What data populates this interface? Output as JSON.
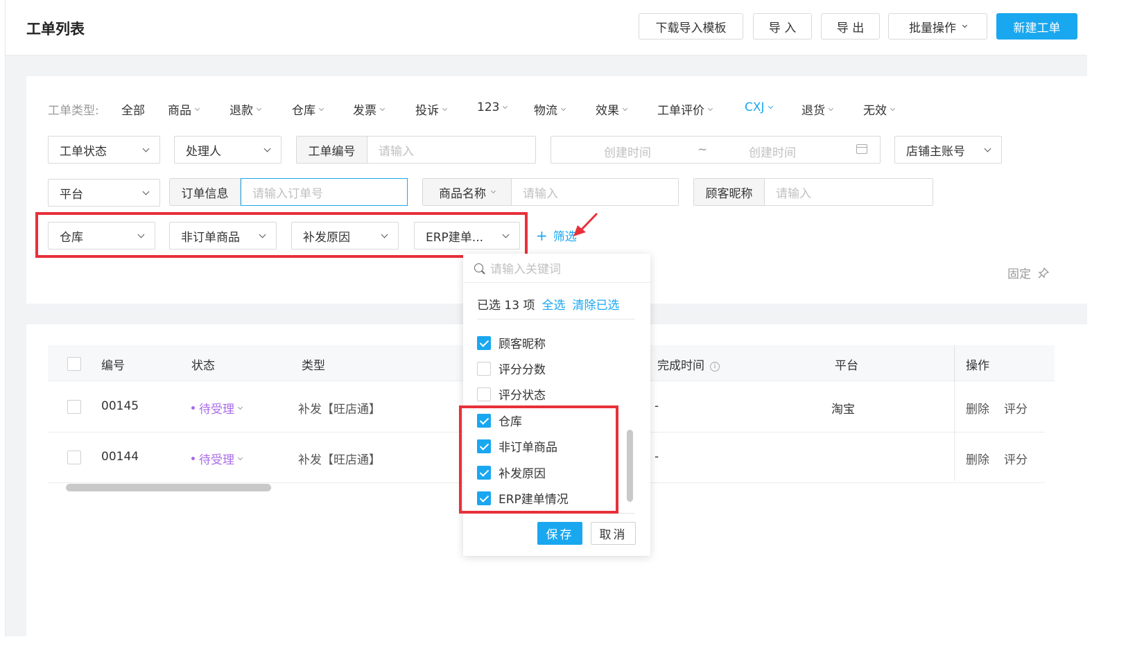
{
  "header": {
    "title": "工单列表",
    "buttons": {
      "download_template": "下载导入模板",
      "import": "导 入",
      "export": "导 出",
      "batch": "批量操作",
      "new_ticket": "新建工单"
    }
  },
  "type_tabs": {
    "label": "工单类型:",
    "items": [
      "全部",
      "商品",
      "退款",
      "仓库",
      "发票",
      "投诉",
      "123",
      "物流",
      "效果",
      "工单评价",
      "CXJ",
      "退货",
      "无效"
    ],
    "active_index": 10
  },
  "filters": {
    "row1": {
      "status": "工单状态",
      "handler": "处理人",
      "ticket_no_label": "工单编号",
      "ticket_no_placeholder": "请输入",
      "date_start": "创建时间",
      "date_sep": "~",
      "date_end": "创建时间",
      "shop_account": "店铺主账号"
    },
    "row2": {
      "platform": "平台",
      "order_info_label": "订单信息",
      "order_info_placeholder": "请输入订单号",
      "product_name_label": "商品名称",
      "product_name_placeholder": "请输入",
      "customer_nick_label": "顾客昵称",
      "customer_nick_placeholder": "请输入"
    },
    "row3": {
      "warehouse": "仓库",
      "non_order_product": "非订单商品",
      "reissue_reason": "补发原因",
      "erp_order": "ERP建单..."
    },
    "add_filter": "筛选",
    "pin": "固定"
  },
  "table": {
    "columns": [
      "编号",
      "状态",
      "类型",
      "完成时间",
      "平台",
      "操作"
    ],
    "rows": [
      {
        "id": "00145",
        "status": "待受理",
        "type": "补发【旺店通】",
        "finish_time": "-",
        "platform": "淘宝",
        "actions": [
          "删除",
          "评分"
        ]
      },
      {
        "id": "00144",
        "status": "待受理",
        "type": "补发【旺店通】",
        "finish_time": "-",
        "platform": "",
        "actions": [
          "删除",
          "评分"
        ]
      }
    ]
  },
  "popup": {
    "search_placeholder": "请输入关键词",
    "selected_text": "已选 13 项",
    "select_all": "全选",
    "clear": "清除已选",
    "options": [
      {
        "label": "顾客昵称",
        "checked": true
      },
      {
        "label": "评分分数",
        "checked": false
      },
      {
        "label": "评分状态",
        "checked": false
      },
      {
        "label": "仓库",
        "checked": true
      },
      {
        "label": "非订单商品",
        "checked": true
      },
      {
        "label": "补发原因",
        "checked": true
      },
      {
        "label": "ERP建单情况",
        "checked": true
      }
    ],
    "save": "保存",
    "cancel": "取消"
  },
  "colors": {
    "primary": "#19a7f0",
    "highlight_box": "#e8303a",
    "status_pending": "#a86ae8"
  }
}
